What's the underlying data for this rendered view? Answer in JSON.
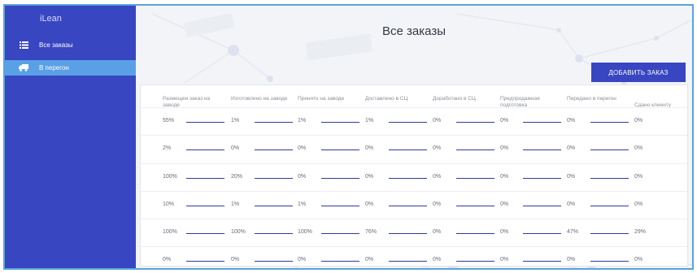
{
  "app": {
    "brand": "iLean"
  },
  "sidebar": {
    "items": [
      {
        "label": "Все заказы",
        "icon": "list-icon"
      },
      {
        "label": "В перегон",
        "icon": "truck-icon",
        "active": true
      }
    ]
  },
  "page": {
    "title": "Все заказы",
    "add_button": "ДОБАВИТЬ ЗАКАЗ"
  },
  "colors": {
    "sidebar": "#3846c1",
    "active_item": "#5aa0e6",
    "accent": "#3846c1",
    "frame": "#5aa3e0"
  },
  "table": {
    "columns": [
      "Размещен заказ на заводе",
      "Изготовлено на заводе",
      "Принято на заводе",
      "Доставлено в СЦ",
      "Доработано в СЦ",
      "Предпродажная подготовка",
      "Передано в перегон",
      "Сдано клиенту"
    ],
    "rows": [
      [
        "55%",
        "1%",
        "1%",
        "1%",
        "0%",
        "0%",
        "0%",
        "0%"
      ],
      [
        "2%",
        "0%",
        "0%",
        "0%",
        "0%",
        "0%",
        "0%",
        "0%"
      ],
      [
        "100%",
        "20%",
        "0%",
        "0%",
        "0%",
        "0%",
        "0%",
        "0%"
      ],
      [
        "10%",
        "1%",
        "1%",
        "0%",
        "0%",
        "0%",
        "0%",
        "0%"
      ],
      [
        "100%",
        "100%",
        "100%",
        "76%",
        "0%",
        "0%",
        "47%",
        "29%"
      ],
      [
        "0%",
        "0%",
        "0%",
        "0%",
        "0%",
        "0%",
        "0%",
        "0%"
      ]
    ]
  }
}
